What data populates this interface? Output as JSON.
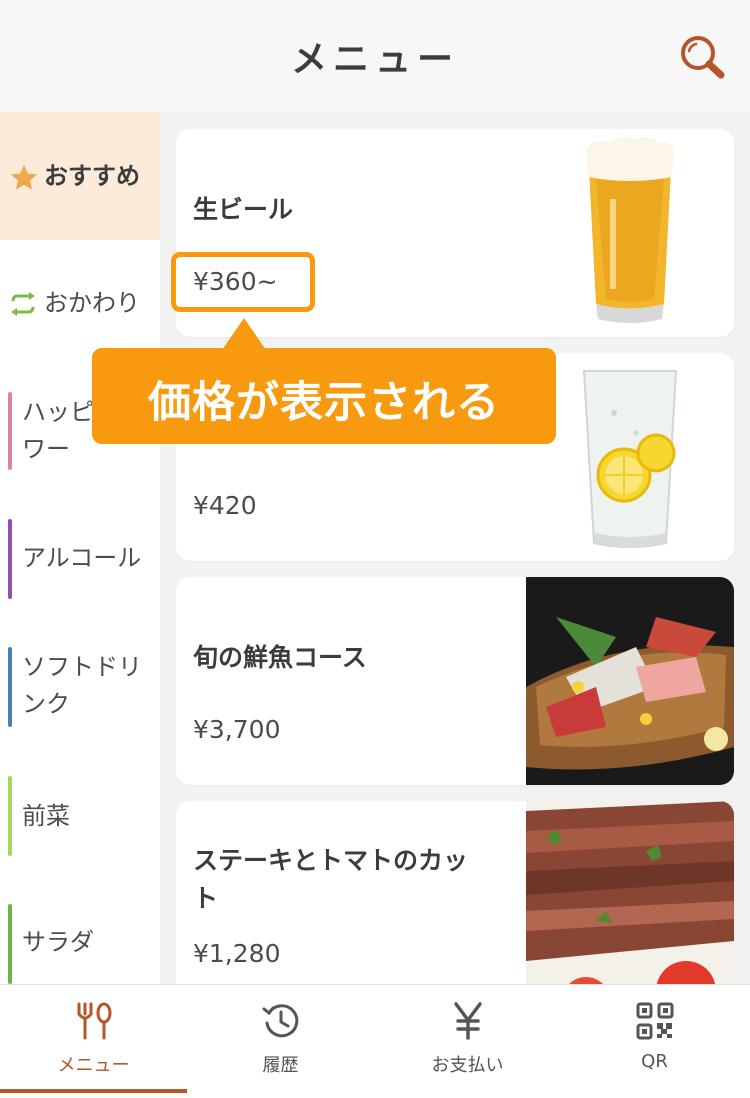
{
  "header": {
    "title": "メニュー",
    "search_icon": "search-icon"
  },
  "sidebar": {
    "items": [
      {
        "label": "おすすめ",
        "icon": "star-icon",
        "active": true
      },
      {
        "label": "おかわり",
        "icon": "refresh-icon"
      },
      {
        "label": "ハッピーアワー",
        "line1": "ハッピ",
        "line2": "ワー",
        "color": "#e17fa6"
      },
      {
        "label": "アルコール",
        "color": "#8e4fb0"
      },
      {
        "label": "ソフトドリンク",
        "line1": "ソフトドリ",
        "line2": "ンク",
        "color": "#4a7fb5"
      },
      {
        "label": "前菜",
        "color": "#a3d85b"
      },
      {
        "label": "サラダ",
        "color": "#6fb247"
      }
    ]
  },
  "items": [
    {
      "name": "生ビール",
      "price": "¥360~",
      "image": "beer-glass"
    },
    {
      "name": "",
      "price": "¥420",
      "image": "lemon-sour-glass"
    },
    {
      "name": "旬の鮮魚コース",
      "price": "¥3,700",
      "image": "sashimi-platter"
    },
    {
      "name": "ステーキとトマトのカット",
      "name_line1": "ステーキとトマトのカッ",
      "name_line2": "ト",
      "price": "¥1,280",
      "image": "steak-tomato"
    }
  ],
  "annotation": {
    "text": "価格が表示される"
  },
  "nav": {
    "tabs": [
      {
        "label": "メニュー",
        "icon": "cutlery-icon",
        "active": true
      },
      {
        "label": "履歴",
        "icon": "history-icon"
      },
      {
        "label": "お支払い",
        "icon": "yen-icon"
      },
      {
        "label": "QR",
        "icon": "qr-icon"
      }
    ]
  },
  "colors": {
    "accent": "#b5562a",
    "highlight": "#f79a0f",
    "active_bg": "#fcebd8"
  }
}
